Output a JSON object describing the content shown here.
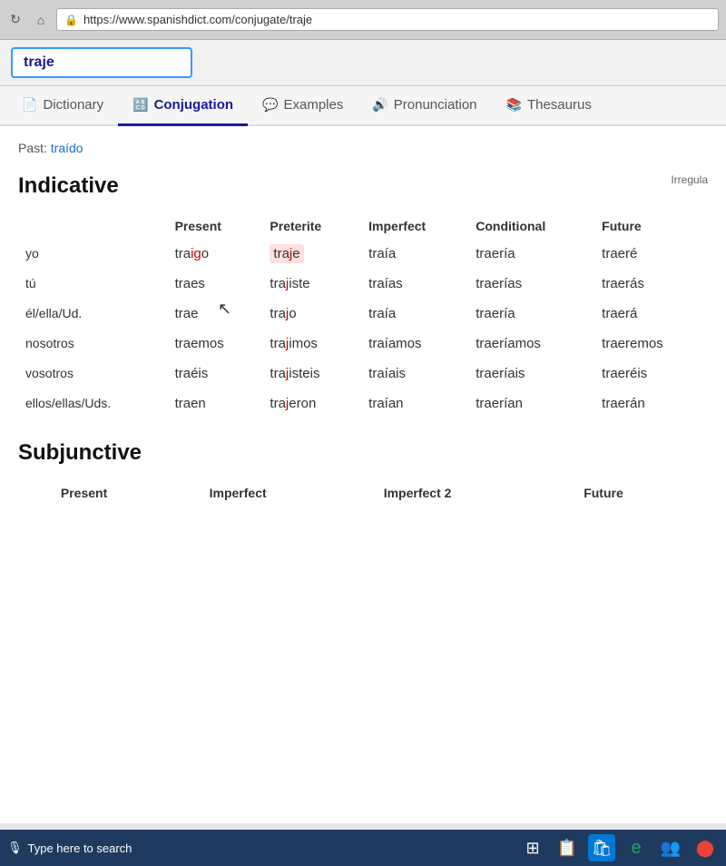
{
  "browser": {
    "url": "https://www.spanishdict.com/conjugate/traje",
    "search_term": "traje"
  },
  "tabs": [
    {
      "id": "dictionary",
      "label": "Dictionary",
      "icon": "📄",
      "active": false
    },
    {
      "id": "conjugation",
      "label": "Conjugation",
      "icon": "🔠",
      "active": true
    },
    {
      "id": "examples",
      "label": "Examples",
      "icon": "💬",
      "active": false
    },
    {
      "id": "pronunciation",
      "label": "Pronunciation",
      "icon": "🔊",
      "active": false
    },
    {
      "id": "thesaurus",
      "label": "Thesaurus",
      "icon": "📚",
      "active": false
    }
  ],
  "past_label": "Past:",
  "past_participle": "traído",
  "indicative_title": "Indicative",
  "irregular_label": "Irregula",
  "columns": {
    "pronoun": "",
    "present": "Present",
    "preterite": "Preterite",
    "imperfect": "Imperfect",
    "conditional": "Conditional",
    "future": "Future"
  },
  "rows": [
    {
      "pronoun": "yo",
      "present": "traigo",
      "present_irregular": "ig",
      "preterite": "traje",
      "preterite_irregular": "j",
      "preterite_highlight": true,
      "imperfect": "traía",
      "conditional": "traería",
      "future": "traeré"
    },
    {
      "pronoun": "tú",
      "present": "traes",
      "preterite": "trajiste",
      "preterite_irregular": "j",
      "imperfect": "traías",
      "conditional": "traerías",
      "future": "traerás"
    },
    {
      "pronoun": "él/ella/Ud.",
      "present": "trae",
      "preterite": "trajo",
      "preterite_irregular": "j",
      "imperfect": "traía",
      "conditional": "traería",
      "future": "traerá"
    },
    {
      "pronoun": "nosotros",
      "present": "traemos",
      "preterite": "trajimos",
      "preterite_irregular": "j",
      "imperfect": "traíamos",
      "conditional": "traeríamos",
      "future": "traeremos"
    },
    {
      "pronoun": "vosotros",
      "present": "traéis",
      "preterite": "trajisteis",
      "preterite_irregular": "j",
      "imperfect": "traíais",
      "conditional": "traeríais",
      "future": "traeréis"
    },
    {
      "pronoun": "ellos/ellas/Uds.",
      "present": "traen",
      "preterite": "trajeron",
      "preterite_irregular": "j",
      "imperfect": "traían",
      "conditional": "traerían",
      "future": "traerán"
    }
  ],
  "subjunctive_title": "Subjunctive",
  "subjunctive_columns": {
    "present": "Present",
    "imperfect": "Imperfect",
    "imperfect2": "Imperfect 2",
    "future": "Future"
  },
  "taskbar": {
    "search_placeholder": "Type here to search"
  }
}
